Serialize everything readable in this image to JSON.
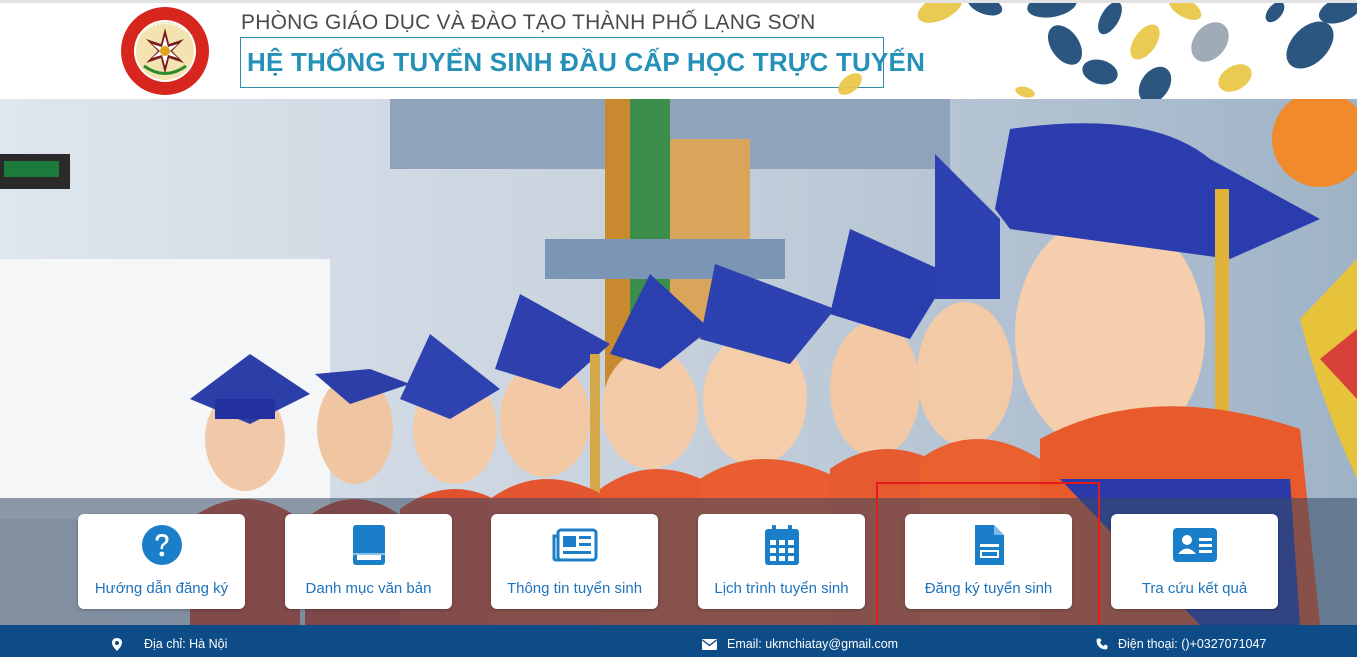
{
  "header": {
    "org_name": "PHÒNG GIÁO DỤC VÀ ĐÀO TẠO THÀNH PHỐ LẠNG SƠN",
    "system_title": "HỆ THỐNG TUYỂN SINH ĐẦU CẤP HỌC TRỰC TUYẾN",
    "logo_icon": "education-department-seal"
  },
  "colors": {
    "title": "#2591b8",
    "menu_text": "#1e73be",
    "footer_bg": "#0d4c86",
    "highlight": "#e41b1b"
  },
  "menu": [
    {
      "label": "Hướng dẫn đăng ký",
      "icon": "question-circle-icon"
    },
    {
      "label": "Danh mục văn bản",
      "icon": "book-icon"
    },
    {
      "label": "Thông tin tuyển sinh",
      "icon": "newspaper-icon"
    },
    {
      "label": "Lịch trình tuyển sinh",
      "icon": "calendar-icon"
    },
    {
      "label": "Đăng ký tuyển sinh",
      "icon": "registration-form-icon"
    },
    {
      "label": "Tra cứu kết quả",
      "icon": "id-card-icon"
    }
  ],
  "footer": {
    "address": "Địa chỉ: Hà Nội",
    "email": "Email: ukmchiatay@gmail.com",
    "phone": "Điện thoại: ()+0327071047"
  }
}
